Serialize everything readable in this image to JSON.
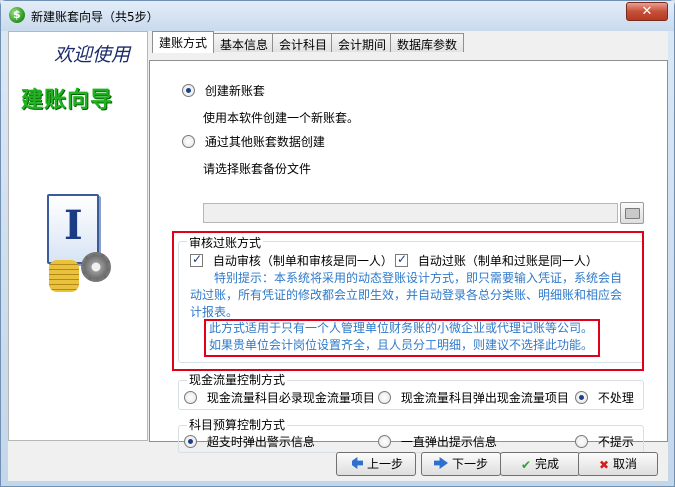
{
  "window": {
    "title": "新建账套向导（共5步）",
    "close": "✕"
  },
  "banner": {
    "welcome": "欢迎使用",
    "wizard_name": "建账向导",
    "logo_letter": "I"
  },
  "tabs": [
    {
      "label": "建账方式",
      "active": true
    },
    {
      "label": "基本信息",
      "active": false
    },
    {
      "label": "会计科目",
      "active": false
    },
    {
      "label": "会计期间",
      "active": false
    },
    {
      "label": "数据库参数",
      "active": false
    }
  ],
  "create_mode": {
    "new": {
      "label": "创建新账套",
      "desc": "使用本软件创建一个新账套。",
      "checked": true
    },
    "backup": {
      "label": "通过其他账套数据创建",
      "file_label": "请选择账套备份文件",
      "file_value": "",
      "checked": false
    }
  },
  "audit": {
    "title": "审核过账方式",
    "auto_audit": {
      "label": "自动审核（制单和审核是同一人）",
      "checked": true
    },
    "auto_post": {
      "label": "自动过账（制单和过账是同一人）",
      "checked": true
    },
    "tip": "特别提示：本系统将采用的动态登账设计方式，即只需要输入凭证，系统会自动过账，所有凭证的修改都会立即生效，并自动登录各总分类账、明细账和相应会计报表。",
    "notice_line1": "此方式适用于只有一个人管理单位财务账的小微企业或代理记账等公司。",
    "notice_line2": "如果贵单位会计岗位设置齐全，且人员分工明细，则建议不选择此功能。"
  },
  "cashflow": {
    "title": "现金流量控制方式",
    "options": [
      {
        "label": "现金流量科目必录现金流量项目",
        "checked": false
      },
      {
        "label": "现金流量科目弹出现金流量项目",
        "checked": false
      },
      {
        "label": "不处理",
        "checked": true
      }
    ]
  },
  "budget": {
    "title": "科目预算控制方式",
    "options": [
      {
        "label": "超支时弹出警示信息",
        "checked": true
      },
      {
        "label": "一直弹出提示信息",
        "checked": false
      },
      {
        "label": "不提示",
        "checked": false
      }
    ]
  },
  "buttons": {
    "prev": "上一步",
    "next": "下一步",
    "finish": "完成",
    "cancel": "取消"
  }
}
